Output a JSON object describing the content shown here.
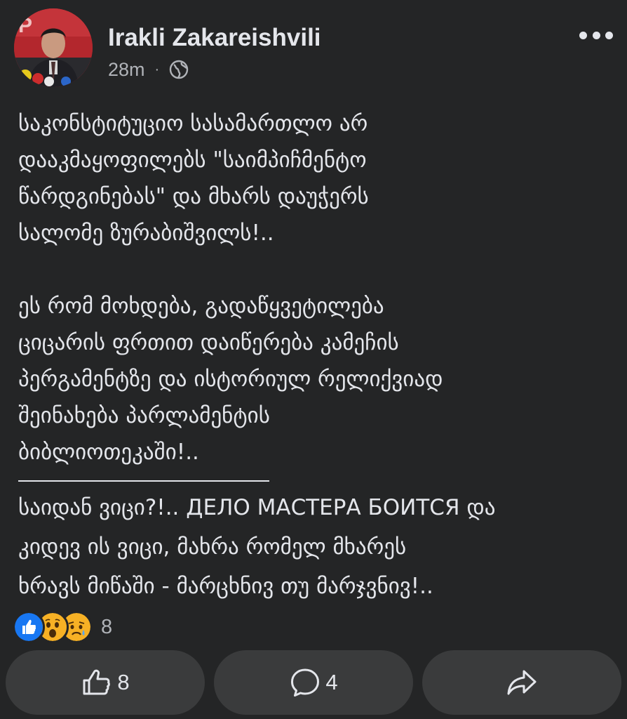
{
  "post": {
    "author_name": "Irakli Zakareishvili",
    "timestamp": "28m",
    "meta_separator": "·",
    "audience_icon": "globe-icon",
    "paragraph_1": [
      "საკონსტიტუციო სასამართლო არ",
      "დააკმაყოფილებს \"საიმპიჩმენტო",
      "წარდგინებას\" და მხარს დაუჭერს",
      "სალომე ზურაბიშვილს!.."
    ],
    "paragraph_2": [
      "ეს რომ მოხდება, გადაწყვეტილება",
      "ციცარის ფრთით დაიწერება კამეჩის",
      "პერგამენტზე და ისტორიულ რელიქვიად",
      "შეინახება პარლამენტის",
      "ბიბლიოთეკაში!.."
    ],
    "separator_text": "___________________",
    "paragraph_3": [
      "საიდან ვიცი?!.. ДЕЛО МАСТЕРА БОИТСЯ და",
      "კიდევ ის ვიცი, მახრა რომელ მხარეს",
      "ხრავს მიწაში - მარცხნივ თუ მარჯვნივ!.."
    ]
  },
  "reactions": {
    "icons": [
      "like-reaction-icon",
      "wow-reaction-icon",
      "sad-reaction-icon"
    ],
    "count": "8"
  },
  "actions": {
    "like_count": "8",
    "comment_count": "4",
    "like_icon": "thumbs-up-icon",
    "comment_icon": "comment-bubble-icon",
    "share_icon": "share-arrow-icon"
  },
  "colors": {
    "background": "#242526",
    "button_background": "#3a3b3c",
    "primary_text": "#e4e6eb",
    "secondary_text": "#b0b3b8",
    "like_blue": "#1877f2",
    "emoji_yellow": "#f7b125"
  }
}
